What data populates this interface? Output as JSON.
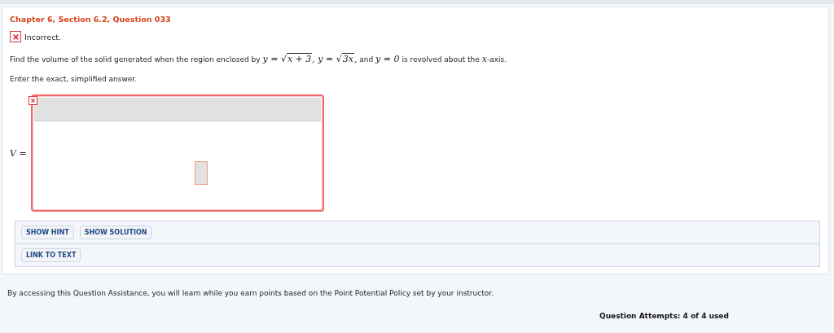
{
  "question": {
    "title": "Chapter 6, Section 6.2, Question 033",
    "result": {
      "correct": false,
      "label": "Incorrect."
    },
    "prompt": [
      {
        "kind": "text",
        "text": "Find the volume of the solid generated when the region enclosed by "
      },
      {
        "kind": "math",
        "text": "y = "
      },
      {
        "kind": "sqrt",
        "sign": "√",
        "text": "x + 3"
      },
      {
        "kind": "math",
        "text": ", y = "
      },
      {
        "kind": "sqrt",
        "sign": "√",
        "text": "3x"
      },
      {
        "kind": "math",
        "text": ","
      },
      {
        "kind": "text",
        "text": " and "
      },
      {
        "kind": "math",
        "text": "y = 0"
      },
      {
        "kind": "text",
        "text": " is revolved about the "
      },
      {
        "kind": "math",
        "text": "x"
      },
      {
        "kind": "text",
        "text": "-axis."
      }
    ],
    "instruction": "Enter the exact, simplified answer.",
    "answer": {
      "label": "V =",
      "correct": false
    }
  },
  "buttons": [
    [
      "SHOW HINT",
      "SHOW SOLUTION"
    ],
    [
      "LINK TO TEXT"
    ]
  ],
  "assistance": "By accessing this Question Assistance, you will learn while you earn points based on the Point Potential Policy set by your instructor.",
  "attempts": "Question Attempts: 4 of 4 used"
}
